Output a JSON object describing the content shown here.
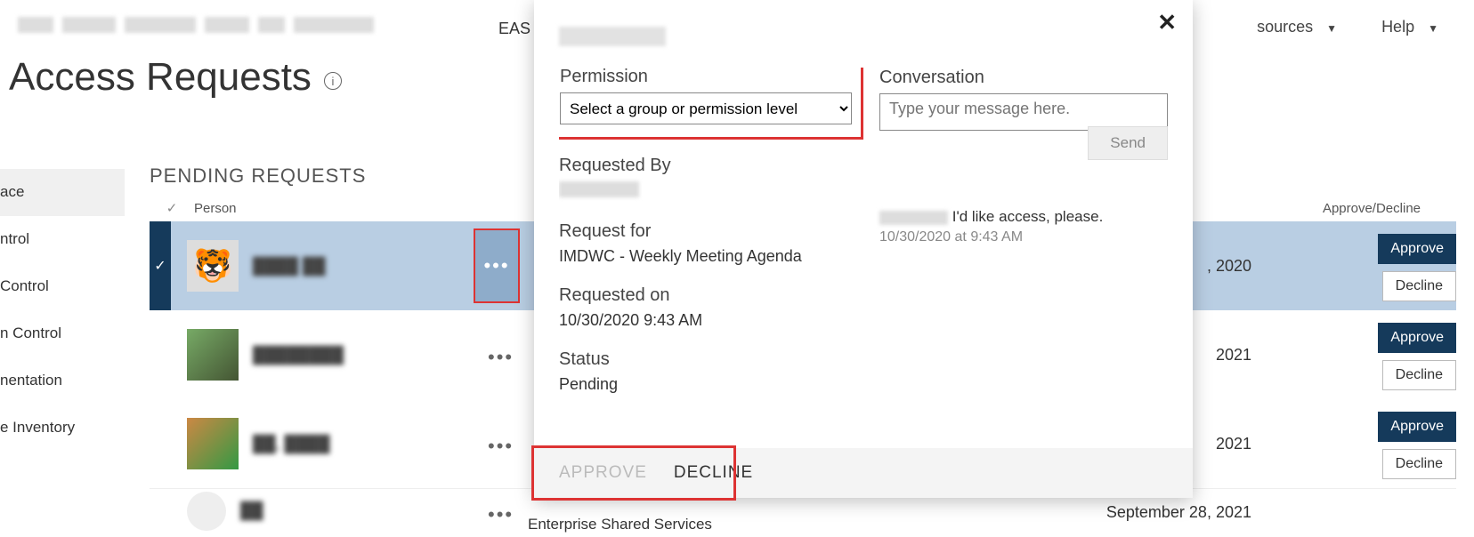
{
  "topnav": {
    "eas_fragment": "EAS",
    "sources_label": "sources",
    "help_label": "Help"
  },
  "page": {
    "title": "Access Requests"
  },
  "leftnav": {
    "items": [
      "ace",
      "ntrol",
      "Control",
      "n Control",
      "nentation",
      "e Inventory"
    ]
  },
  "section": {
    "title": "PENDING REQUESTS",
    "col_person": "Person",
    "col_approve": "Approve/Decline"
  },
  "rows": [
    {
      "avatar_emoji": "🐯",
      "date": ", 2020",
      "for": ""
    },
    {
      "avatar_emoji": "",
      "date": "2021",
      "for": ""
    },
    {
      "avatar_emoji": "",
      "date": "2021",
      "for": ""
    },
    {
      "avatar_emoji": "",
      "date": "September 28, 2021",
      "for": "Enterprise Shared Services"
    }
  ],
  "buttons": {
    "approve": "Approve",
    "decline": "Decline"
  },
  "popup": {
    "permission_label": "Permission",
    "permission_select_text": "Select a group or permission level",
    "requested_by_label": "Requested By",
    "request_for_label": "Request for",
    "request_for_value": "IMDWC - Weekly Meeting Agenda",
    "requested_on_label": "Requested on",
    "requested_on_value": "10/30/2020 9:43 AM",
    "status_label": "Status",
    "status_value": "Pending",
    "conversation_label": "Conversation",
    "conversation_placeholder": "Type your message here.",
    "send_label": "Send",
    "conv_message_text": "I'd like access, please.",
    "conv_message_time": "10/30/2020 at 9:43 AM",
    "footer_approve": "APPROVE",
    "footer_decline": "DECLINE"
  }
}
